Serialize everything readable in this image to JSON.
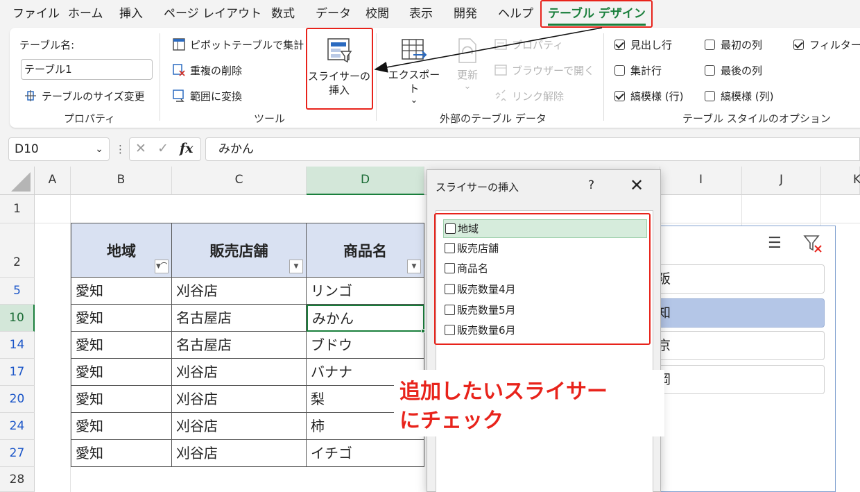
{
  "menu": {
    "items": [
      "ファイル",
      "ホーム",
      "挿入",
      "ページ レイアウト",
      "数式",
      "データ",
      "校閲",
      "表示",
      "開発",
      "ヘルプ",
      "テーブル デザイン"
    ],
    "active_index": 10
  },
  "ribbon": {
    "table_name_label": "テーブル名:",
    "table_name_value": "テーブル1",
    "resize_table": "テーブルのサイズ変更",
    "group_properties": "プロパティ",
    "pivot_summarize": "ピボットテーブルで集計",
    "remove_duplicates": "重複の削除",
    "convert_to_range": "範囲に変換",
    "group_tools": "ツール",
    "insert_slicer_line1": "スライサーの",
    "insert_slicer_line2": "挿入",
    "export": "エクスポート",
    "refresh": "更新",
    "properties": "プロパティ",
    "open_in_browser": "ブラウザーで開く",
    "unlink": "リンク解除",
    "group_external": "外部のテーブル データ",
    "header_row": "見出し行",
    "first_column": "最初の列",
    "filter_button": "フィルター ボ",
    "total_row": "集計行",
    "last_column": "最後の列",
    "banded_rows": "縞模様 (行)",
    "banded_columns": "縞模様 (列)",
    "group_style_options": "テーブル スタイルのオプション",
    "header_row_checked": true,
    "first_column_checked": false,
    "filter_button_checked": true,
    "total_row_checked": false,
    "last_column_checked": false,
    "banded_rows_checked": true,
    "banded_columns_checked": false
  },
  "formula_bar": {
    "name_box": "D10",
    "cancel": "✕",
    "enter": "✓",
    "fx": "fx",
    "formula": "みかん"
  },
  "sheet": {
    "columns": [
      "A",
      "B",
      "C",
      "D",
      "I",
      "J",
      "K"
    ],
    "rows": [
      "1",
      "2",
      "5",
      "10",
      "14",
      "17",
      "20",
      "24",
      "27",
      "28"
    ],
    "headers": [
      "地域",
      "販売店舗",
      "商品名"
    ],
    "data": [
      [
        "愛知",
        "刈谷店",
        "リンゴ"
      ],
      [
        "愛知",
        "名古屋店",
        "みかん"
      ],
      [
        "愛知",
        "名古屋店",
        "ブドウ"
      ],
      [
        "愛知",
        "刈谷店",
        "バナナ"
      ],
      [
        "愛知",
        "刈谷店",
        "梨"
      ],
      [
        "愛知",
        "刈谷店",
        "柿"
      ],
      [
        "愛知",
        "刈谷店",
        "イチゴ"
      ]
    ]
  },
  "slicer": {
    "items": [
      "阪",
      "知",
      "京",
      "岡"
    ],
    "selected_index": 1
  },
  "dialog": {
    "title": "スライサーの挿入",
    "help": "?",
    "close": "✕",
    "fields": [
      "地域",
      "販売店舗",
      "商品名",
      "販売数量4月",
      "販売数量5月",
      "販売数量6月"
    ]
  },
  "annotation": {
    "line1": "追加したいスライサー",
    "line2": "にチェック",
    "color": "#e8231b"
  },
  "colors": {
    "accent_green": "#1a7f3c",
    "header_fill": "#d9e1f2",
    "slicer_selected": "#b4c6e7"
  }
}
